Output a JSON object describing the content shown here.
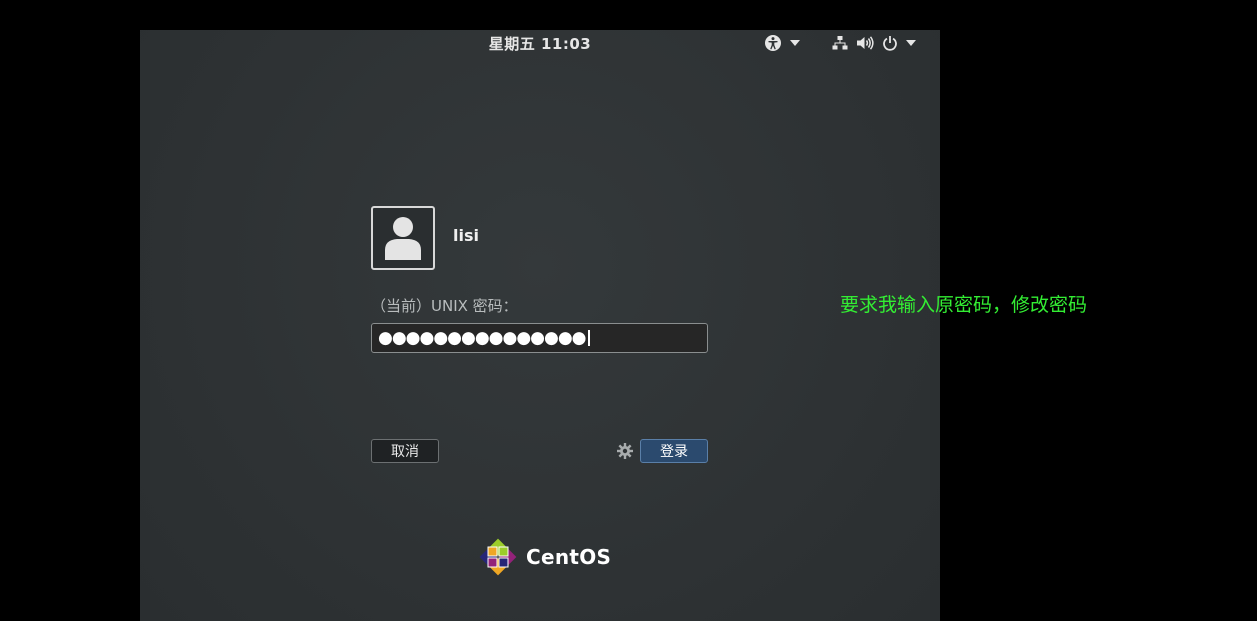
{
  "topbar": {
    "clock": "星期五 11:03",
    "icons": [
      "accessibility-icon",
      "chevron-down-icon",
      "network-icon",
      "volume-icon",
      "power-icon",
      "chevron-down-icon"
    ]
  },
  "login": {
    "username": "lisi",
    "prompt": "（当前）UNIX 密码：",
    "password_masked": "●●●●●●●●●●●●●●●",
    "cancel_label": "取消",
    "login_label": "登录"
  },
  "branding": {
    "logo_text": "CentOS"
  },
  "annotation": {
    "text": "要求我输入原密码，修改密码",
    "color": "#33ee33"
  },
  "colors": {
    "background": "#2e3234",
    "accent_button": "#2b4a6e"
  }
}
